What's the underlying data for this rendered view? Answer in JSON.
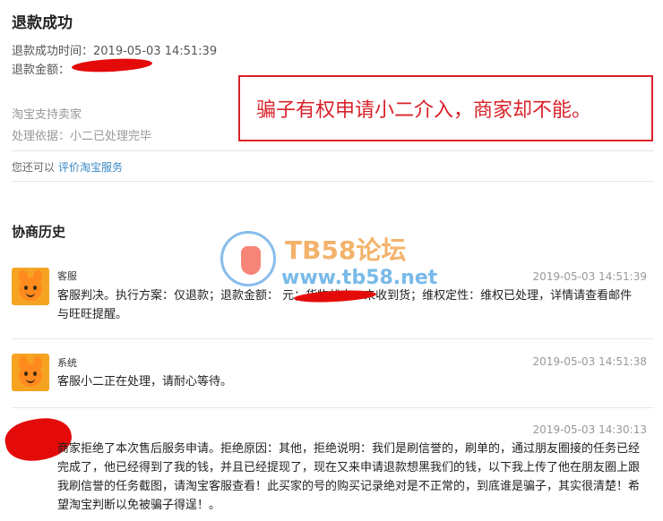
{
  "refund": {
    "title": "退款成功",
    "success_time_label": "退款成功时间：",
    "success_time_value": "2019-05-03 14:51:39",
    "amount_label": "退款金额：",
    "support_text": "淘宝支持卖家",
    "basis_text": "处理依据：小二已处理完毕",
    "rate_prefix": "您还可以",
    "rate_link": "评价淘宝服务"
  },
  "callout": {
    "text": "骗子有权申请小二介入，商家却不能。"
  },
  "watermark": {
    "title": "TB58论坛",
    "url": "www.tb58.net"
  },
  "history": {
    "title": "协商历史",
    "entries": [
      {
        "sender": "客服",
        "time": "2019-05-03 14:51:39",
        "message": "客服判决。执行方案：仅退款；退款金额：                元；货物状态：未收到货；维权定性：维权已处理，详情请查看邮件与旺旺提醒。"
      },
      {
        "sender": "系统",
        "time": "2019-05-03 14:51:38",
        "message": "客服小二正在处理，请耐心等待。"
      },
      {
        "sender": "",
        "time": "2019-05-03 14:30:13",
        "message": "商家拒绝了本次售后服务申请。拒绝原因：其他，拒绝说明：我们是刷信誉的，刷单的，通过朋友圈接的任务已经完成了，他已经得到了我的钱，并且已经提现了，现在又来申请退款想黑我们的钱，以下我上传了他在朋友圈上跟我刷信誉的任务截图，请淘宝客服查看！此买家的号的购买记录绝对是不正常的，到底谁是骗子，其实很清楚！希望淘宝判断以免被骗子得逞！。"
      }
    ]
  },
  "colors": {
    "accent_red": "#d9222a",
    "link_blue": "#3a88c5",
    "redaction": "#e40a0a"
  },
  "icons": {
    "avatar": "mascot-avatar-icon",
    "watermark_logo": "hand-logo-icon"
  }
}
